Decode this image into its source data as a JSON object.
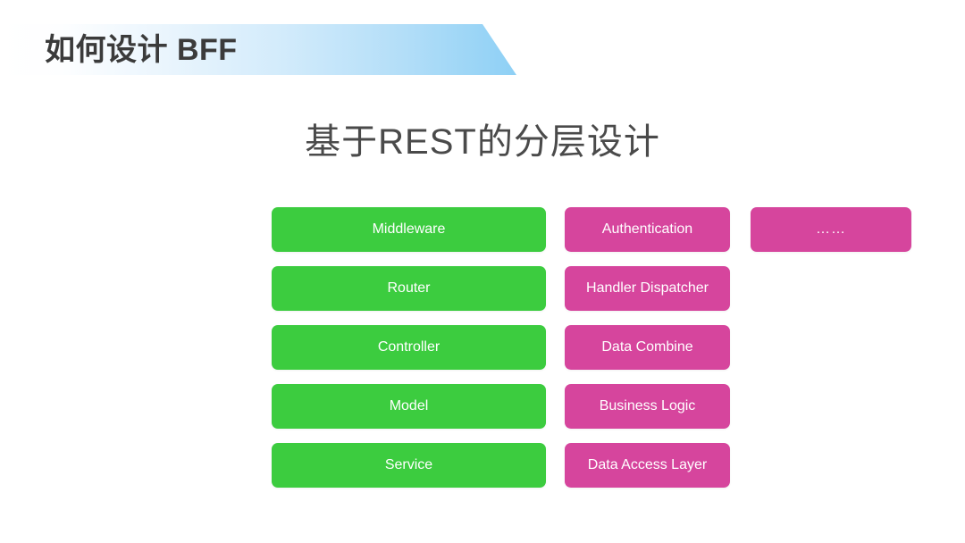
{
  "header": {
    "title": "如何设计 BFF",
    "banner_gradient_start": "#ffffff",
    "banner_gradient_end": "#8ed0f5",
    "title_color": "#3b3b3b"
  },
  "subtitle": {
    "text": "基于REST的分层设计",
    "color": "#4a4a4a"
  },
  "colors": {
    "green": "#3ccc3f",
    "pink": "#d6459d",
    "box_text": "#ffffff"
  },
  "diagram": {
    "columns": [
      {
        "name": "rest-layer-column",
        "color": "green",
        "boxes": [
          {
            "label": "Middleware"
          },
          {
            "label": "Router"
          },
          {
            "label": "Controller"
          },
          {
            "label": "Model"
          },
          {
            "label": "Service"
          }
        ]
      },
      {
        "name": "responsibility-column",
        "color": "pink",
        "boxes": [
          {
            "label": "Authentication"
          },
          {
            "label": "Handler Dispatcher"
          },
          {
            "label": "Data Combine"
          },
          {
            "label": "Business Logic"
          },
          {
            "label": "Data Access Layer"
          }
        ]
      },
      {
        "name": "more-column",
        "color": "pink",
        "boxes": [
          {
            "label": "……"
          }
        ]
      }
    ]
  }
}
